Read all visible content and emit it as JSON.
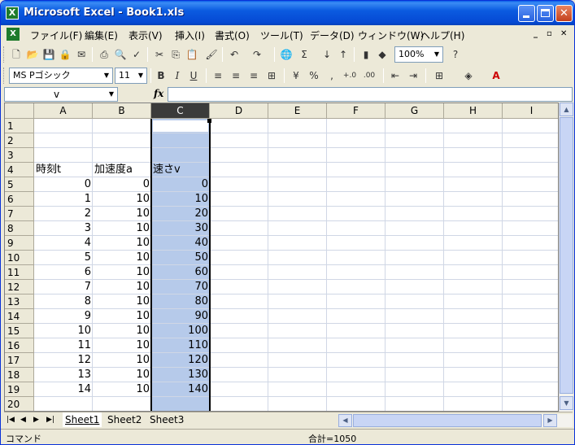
{
  "window": {
    "title": "Microsoft Excel - Book1.xls",
    "icon_name": "excel-icon"
  },
  "menu": {
    "items": [
      "ファイル(F)",
      "編集(E)",
      "表示(V)",
      "挿入(I)",
      "書式(O)",
      "ツール(T)",
      "データ(D)",
      "ウィンドウ(W)",
      "ヘルプ(H)"
    ]
  },
  "toolbar": {
    "zoom": "100%",
    "font_name": "MS Pゴシック",
    "font_size": "11"
  },
  "formula_bar": {
    "name_box": "v",
    "fx_label": "fx",
    "formula": ""
  },
  "grid": {
    "columns": [
      "A",
      "B",
      "C",
      "D",
      "E",
      "F",
      "G",
      "H",
      "I"
    ],
    "selected_column": "C",
    "rows": [
      "1",
      "2",
      "3",
      "4",
      "5",
      "6",
      "7",
      "8",
      "9",
      "10",
      "11",
      "12",
      "13",
      "14",
      "15",
      "16",
      "17",
      "18",
      "19",
      "20"
    ],
    "headers": {
      "A": "時刻t",
      "B": "加速度a",
      "C": "速さv"
    },
    "data": [
      [
        "0",
        "0",
        "0"
      ],
      [
        "1",
        "10",
        "10"
      ],
      [
        "2",
        "10",
        "20"
      ],
      [
        "3",
        "10",
        "30"
      ],
      [
        "4",
        "10",
        "40"
      ],
      [
        "5",
        "10",
        "50"
      ],
      [
        "6",
        "10",
        "60"
      ],
      [
        "7",
        "10",
        "70"
      ],
      [
        "8",
        "10",
        "80"
      ],
      [
        "9",
        "10",
        "90"
      ],
      [
        "10",
        "10",
        "100"
      ],
      [
        "11",
        "10",
        "110"
      ],
      [
        "12",
        "10",
        "120"
      ],
      [
        "13",
        "10",
        "130"
      ],
      [
        "14",
        "10",
        "140"
      ]
    ]
  },
  "sheets": [
    "Sheet1",
    "Sheet2",
    "Sheet3"
  ],
  "status": {
    "mode": "コマンド",
    "sum": "合計=1050"
  }
}
